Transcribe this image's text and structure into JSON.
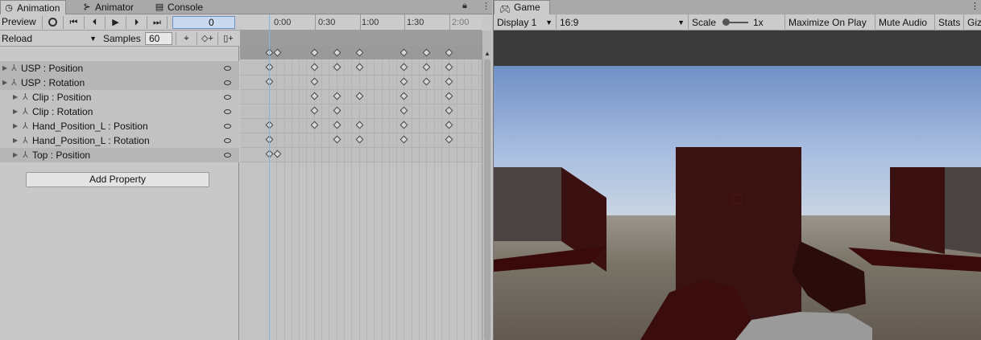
{
  "tabs": [
    {
      "label": "Animation",
      "icon": "animation-clock-icon",
      "active": true
    },
    {
      "label": "Animator",
      "icon": "animator-icon",
      "active": false
    },
    {
      "label": "Console",
      "icon": "console-icon",
      "active": false
    }
  ],
  "toolbar": {
    "preview_label": "Preview",
    "frame_value": "0",
    "clip_name": "Reload",
    "samples_label": "Samples",
    "samples_value": "60"
  },
  "ruler": {
    "ticks": [
      "0:00",
      "0:30",
      "1:00",
      "1:30",
      "2:00"
    ]
  },
  "properties": [
    {
      "label": "USP : Position",
      "indent": 0,
      "shade": "dark"
    },
    {
      "label": "USP : Rotation",
      "indent": 0,
      "shade": "dark"
    },
    {
      "label": "Clip : Position",
      "indent": 1,
      "shade": "light"
    },
    {
      "label": "Clip : Rotation",
      "indent": 1,
      "shade": "light"
    },
    {
      "label": "Hand_Position_L : Position",
      "indent": 1,
      "shade": "light"
    },
    {
      "label": "Hand_Position_L : Rotation",
      "indent": 1,
      "shade": "light"
    },
    {
      "label": "Top : Position",
      "indent": 1,
      "shade": "dark"
    }
  ],
  "add_property_label": "Add Property",
  "game": {
    "tab_label": "Game",
    "display": "Display 1",
    "aspect": "16:9",
    "scale_label": "Scale",
    "scale_value": "1x",
    "maximize_label": "Maximize On Play",
    "mute_label": "Mute Audio",
    "stats_label": "Stats",
    "gizmos_label": "Giz"
  }
}
